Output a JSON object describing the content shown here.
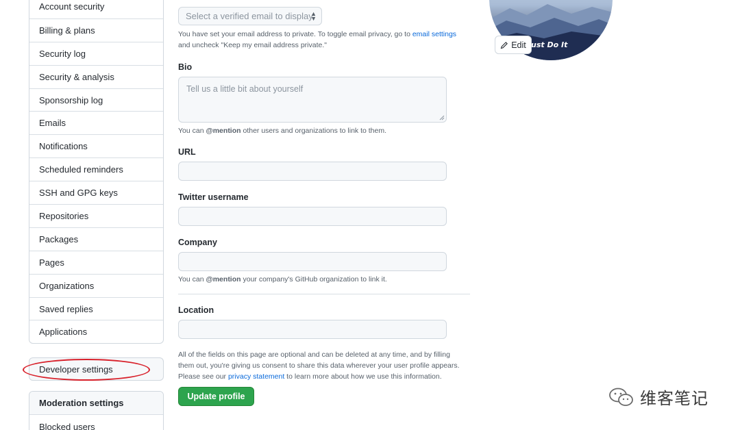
{
  "sidebar": {
    "items": [
      {
        "label": "Account security"
      },
      {
        "label": "Billing & plans"
      },
      {
        "label": "Security log"
      },
      {
        "label": "Security & analysis"
      },
      {
        "label": "Sponsorship log"
      },
      {
        "label": "Emails"
      },
      {
        "label": "Notifications"
      },
      {
        "label": "Scheduled reminders"
      },
      {
        "label": "SSH and GPG keys"
      },
      {
        "label": "Repositories"
      },
      {
        "label": "Packages"
      },
      {
        "label": "Pages"
      },
      {
        "label": "Organizations"
      },
      {
        "label": "Saved replies"
      },
      {
        "label": "Applications"
      }
    ],
    "developer_settings": "Developer settings",
    "moderation": {
      "heading": "Moderation settings",
      "items": [
        {
          "label": "Blocked users"
        }
      ]
    }
  },
  "form": {
    "email_select": "Select a verified email to display",
    "email_note_prefix": "You have set your email address to private. To toggle email privacy, go to ",
    "email_note_link": "email settings",
    "email_note_suffix": "and uncheck \"Keep my email address private.\"",
    "bio_label": "Bio",
    "bio_placeholder": "Tell us a little bit about yourself",
    "bio_note_prefix": "You can ",
    "bio_note_mention": "@mention",
    "bio_note_suffix": " other users and organizations to link to them.",
    "url_label": "URL",
    "url_value": "",
    "twitter_label": "Twitter username",
    "twitter_value": "",
    "company_label": "Company",
    "company_value": "",
    "company_note_prefix": "You can ",
    "company_note_mention": "@mention",
    "company_note_suffix": " your company's GitHub organization to link it.",
    "location_label": "Location",
    "location_value": "",
    "footer_line1": "All of the fields on this page are optional and can be deleted at any time, and by filling",
    "footer_line2": "them out, you're giving us consent to share this data wherever your user profile appears.",
    "footer_line3_prefix": "Please see our ",
    "footer_link": "privacy statement",
    "footer_line3_suffix": " to learn more about how we use this information.",
    "update_button": "Update profile"
  },
  "avatar": {
    "overlay_text": "ust Do It",
    "edit_label": "Edit"
  },
  "watermark": {
    "text": "维客笔记"
  },
  "colors": {
    "accent_link": "#0969da",
    "primary_button": "#2da44e",
    "highlight_ring": "#d8202a"
  }
}
